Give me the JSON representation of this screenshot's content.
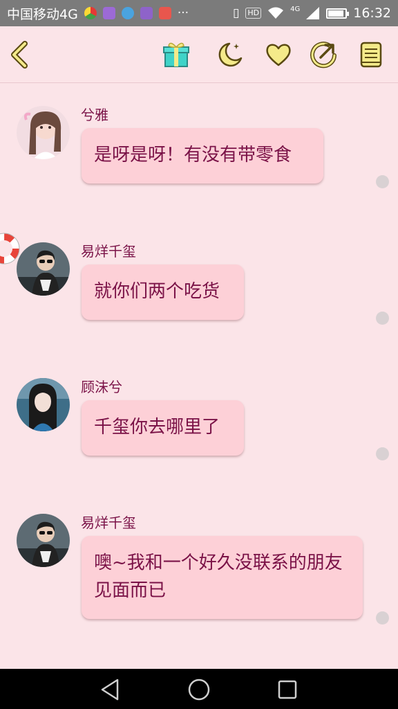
{
  "status_bar": {
    "carrier": "中国移动4G",
    "network": "4G",
    "hd": "HD",
    "time": "16:32",
    "battery_level": 0.85,
    "app_icons": [
      "chrome-icon",
      "gallery-icon",
      "browser-icon",
      "keyboard-icon",
      "weibo-icon"
    ],
    "more": "···"
  },
  "toolbar": {
    "icons": [
      "back-icon",
      "gift-icon",
      "moon-icon",
      "heart-icon",
      "share-icon",
      "notebook-icon"
    ],
    "accent": "#f4ea8a",
    "gift_color": "#3fd3c8"
  },
  "messages": [
    {
      "sender": "兮雅",
      "text": "是呀是呀！有没有带零食",
      "avatar": "avatar-girl-pink"
    },
    {
      "sender": "易烊千玺",
      "text": "就你们两个吃货",
      "avatar": "avatar-boy-sunglasses",
      "badge": "lifebuoy-icon"
    },
    {
      "sender": "顾沫兮",
      "text": "千玺你去哪里了",
      "avatar": "avatar-girl-blue"
    },
    {
      "sender": "易烊千玺",
      "text": "噢~我和一个好久没联系的朋友见面而已",
      "avatar": "avatar-boy-sunglasses"
    }
  ],
  "colors": {
    "background": "#fbe4e8",
    "bubble": "#fdd0d7",
    "text": "#7a1247"
  },
  "nav_bar": {
    "icons": [
      "back-triangle-icon",
      "home-circle-icon",
      "recents-square-icon"
    ]
  }
}
